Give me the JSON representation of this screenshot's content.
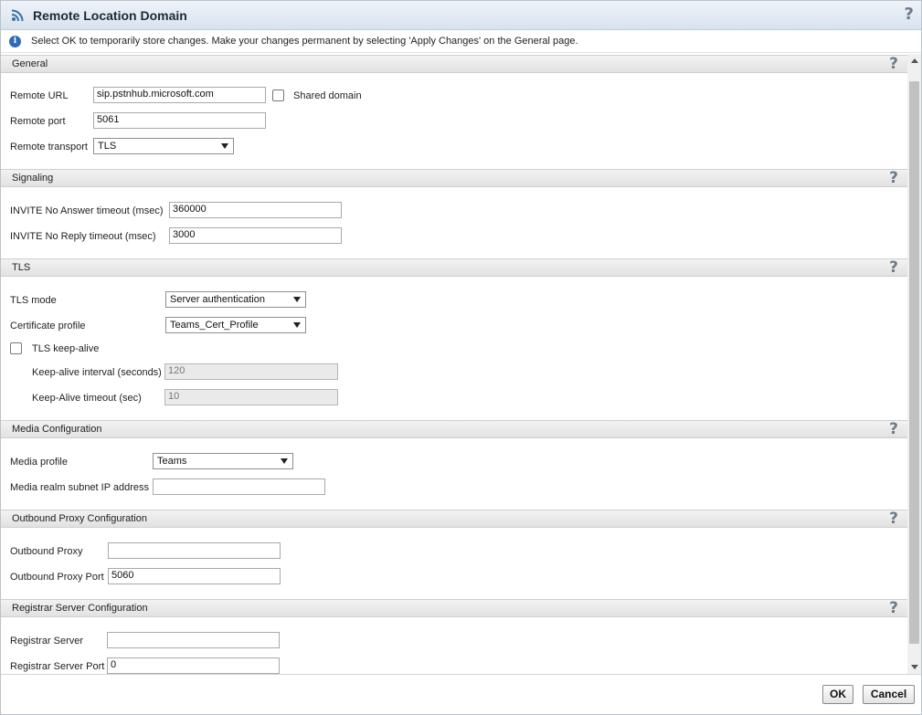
{
  "title": "Remote Location Domain",
  "help_symbol": "?",
  "info": {
    "text": "Select OK to temporarily store changes. Make your changes permanent by selecting 'Apply Changes' on the General page.",
    "icon": "info-icon"
  },
  "sections": {
    "general": {
      "title": "General",
      "remote_url_label": "Remote URL",
      "remote_url_value": "sip.pstnhub.microsoft.com",
      "shared_domain_label": "Shared domain",
      "shared_domain_checked": false,
      "remote_port_label": "Remote port",
      "remote_port_value": "5061",
      "remote_transport_label": "Remote transport",
      "remote_transport_value": "TLS"
    },
    "signaling": {
      "title": "Signaling",
      "no_answer_label": "INVITE No Answer timeout (msec)",
      "no_answer_value": "360000",
      "no_reply_label": "INVITE No Reply timeout (msec)",
      "no_reply_value": "3000"
    },
    "tls": {
      "title": "TLS",
      "mode_label": "TLS mode",
      "mode_value": "Server authentication",
      "cert_label": "Certificate profile",
      "cert_value": "Teams_Cert_Profile",
      "keepalive_label": "TLS keep-alive",
      "keepalive_checked": false,
      "interval_label": "Keep-alive interval (seconds)",
      "interval_value": "120",
      "timeout_label": "Keep-Alive timeout (sec)",
      "timeout_value": "10"
    },
    "media": {
      "title": "Media Configuration",
      "profile_label": "Media profile",
      "profile_value": "Teams",
      "realm_label": "Media realm subnet IP address",
      "realm_value": ""
    },
    "outbound": {
      "title": "Outbound Proxy Configuration",
      "proxy_label": "Outbound Proxy",
      "proxy_value": "",
      "port_label": "Outbound Proxy Port",
      "port_value": "5060"
    },
    "registrar": {
      "title": "Registrar Server Configuration",
      "server_label": "Registrar Server",
      "server_value": "",
      "port_label": "Registrar Server Port",
      "port_value": "0"
    }
  },
  "buttons": {
    "ok": "OK",
    "cancel": "Cancel"
  },
  "colors": {
    "info_icon": "#2d6cb4",
    "title_text": "#1f2a36",
    "help_icon": "#6d7a88"
  }
}
